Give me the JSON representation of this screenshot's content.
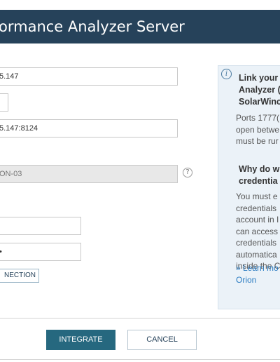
{
  "header": {
    "title": "ormance Analyzer Server"
  },
  "form": {
    "host_value": "5.147",
    "port_value": "",
    "url_value": "5.147:8124",
    "server_value": "ON-03",
    "help_icon_glyph": "?",
    "username_value": "",
    "password_value": "•",
    "test_connection_label": "NECTION"
  },
  "info": {
    "icon_glyph": "i",
    "heading_lines": [
      "Link your",
      "Analyzer (",
      "SolarWinc"
    ],
    "ports_lines": [
      "Ports 1777(",
      "open betwe",
      "must be rur"
    ],
    "why_lines": [
      "Why do w",
      "credentia"
    ],
    "body_lines": [
      "You must e",
      "credentials",
      "account in I",
      "can access",
      "credentials",
      "automatica",
      "inside the C"
    ],
    "link_lines": [
      "» Learn mo",
      "Orion"
    ]
  },
  "footer": {
    "integrate_label": "INTEGRATE",
    "cancel_label": "CANCEL"
  },
  "colors": {
    "header_bg": "#26425a",
    "primary_button": "#26687f",
    "info_panel_bg": "#ebf2f8",
    "link": "#2b7cc2"
  }
}
